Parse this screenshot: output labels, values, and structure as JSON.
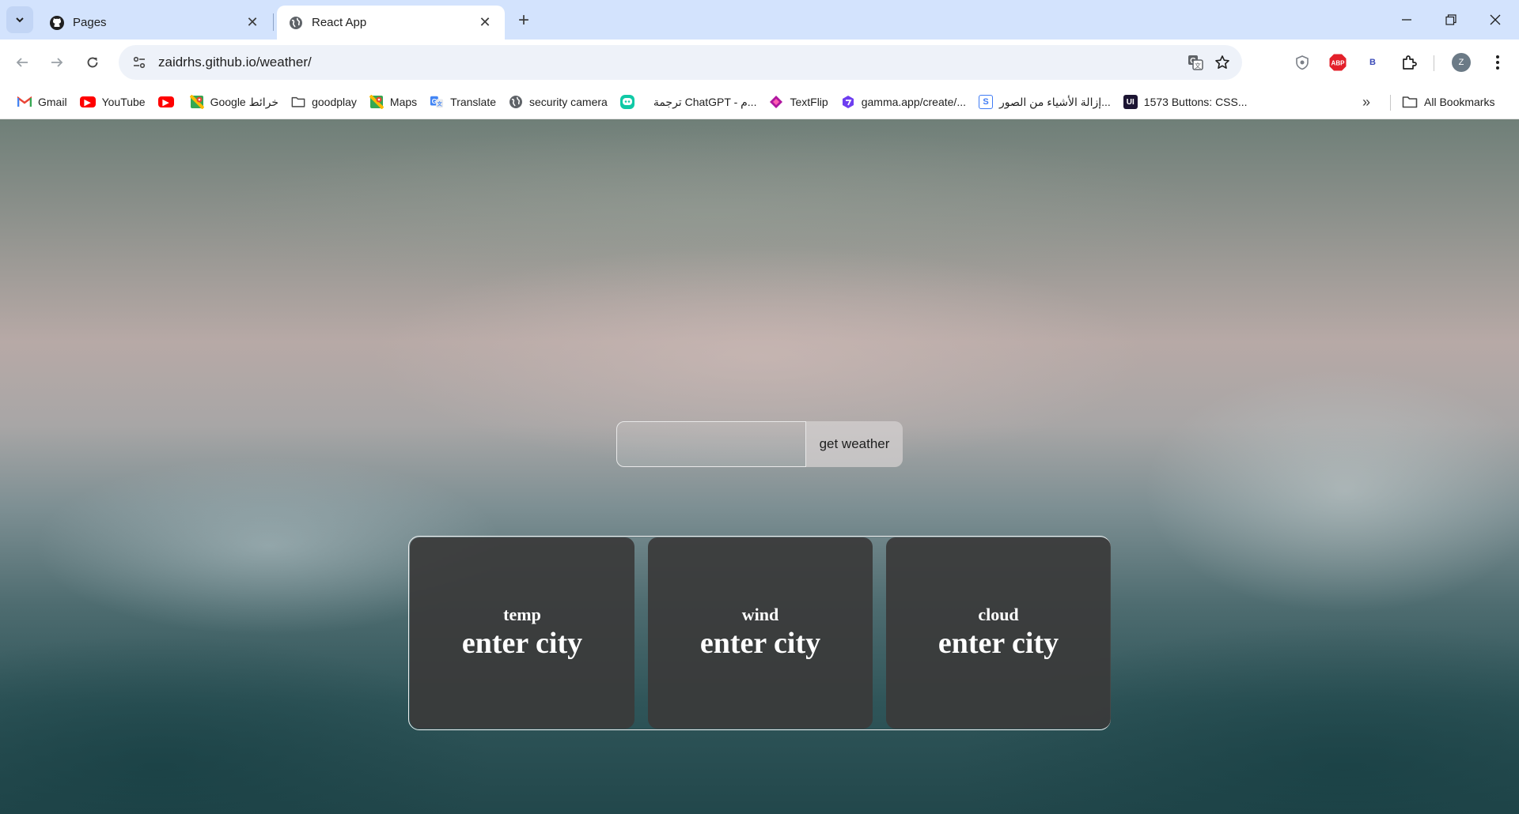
{
  "browser": {
    "tabs": [
      {
        "title": "Pages",
        "icon": "github-icon"
      },
      {
        "title": "React App",
        "icon": "globe-icon"
      }
    ],
    "url": "zaidrhs.github.io/weather/",
    "profile_initial": "Z",
    "extension_b_label": "B",
    "abp_label": "ABP",
    "bookmarks": [
      {
        "label": "Gmail",
        "icon": "gmail-icon",
        "color": "#ea4335"
      },
      {
        "label": "YouTube",
        "icon": "youtube-icon",
        "color": "#ff0000"
      },
      {
        "label": "",
        "icon": "youtube-icon",
        "color": "#ff0000"
      },
      {
        "label": "Google خرائط",
        "icon": "maps-icon",
        "color": "#34a853"
      },
      {
        "label": "goodplay",
        "icon": "folder-icon",
        "color": "#474747"
      },
      {
        "label": "Maps",
        "icon": "maps-icon",
        "color": "#34a853"
      },
      {
        "label": "Translate",
        "icon": "translate-icon",
        "color": "#4285f4"
      },
      {
        "label": "security camera",
        "icon": "globe-icon",
        "color": "#474747"
      },
      {
        "label": "",
        "icon": "chatbot-icon",
        "color": "#10c9a6"
      },
      {
        "label": "ترجمة ChatGPT - م...",
        "icon": "",
        "color": ""
      },
      {
        "label": "TextFlip",
        "icon": "textflip-icon",
        "color": "#b0179f"
      },
      {
        "label": "gamma.app/create/...",
        "icon": "gamma-icon",
        "color": "#6e3ef0"
      },
      {
        "label": "إزالة الأشياء من الصور...",
        "icon": "s-icon",
        "color": "#3f7bf5"
      },
      {
        "label": "1573 Buttons: CSS...",
        "icon": "uiverse-icon",
        "color": "#1c1533"
      }
    ],
    "all_bookmarks_label": "All Bookmarks"
  },
  "app": {
    "search": {
      "placeholder": "",
      "value": ""
    },
    "get_weather_label": "get weather",
    "cards": [
      {
        "label": "temp",
        "value": "enter city"
      },
      {
        "label": "wind",
        "value": "enter city"
      },
      {
        "label": "cloud",
        "value": "enter city"
      }
    ]
  }
}
